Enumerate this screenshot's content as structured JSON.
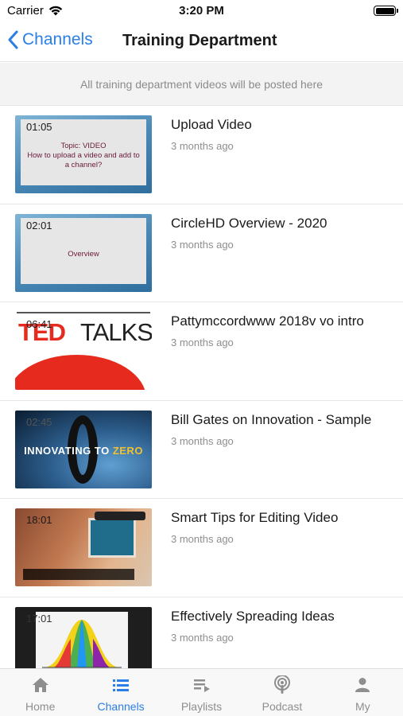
{
  "status_bar": {
    "carrier": "Carrier",
    "time": "3:20 PM"
  },
  "nav": {
    "back_label": "Channels",
    "title": "Training Department"
  },
  "banner": {
    "text": "All training department videos will be posted here"
  },
  "videos": [
    {
      "title": "Upload Video",
      "date": "3 months ago",
      "duration": "01:05",
      "thumb_text": "Topic: VIDEO\nHow to upload a video and add to a channel?"
    },
    {
      "title": "CircleHD Overview - 2020",
      "date": "3 months ago",
      "duration": "02:01",
      "thumb_text": "Overview"
    },
    {
      "title": "Pattymccordwww 2018v vo intro",
      "date": "3 months ago",
      "duration": "06:41",
      "thumb_ted": "TED",
      "thumb_talks": "TALKS"
    },
    {
      "title": "Bill Gates on Innovation - Sample",
      "date": "3 months ago",
      "duration": "02:45",
      "thumb_caption": "INNOVATING TO",
      "thumb_caption_zero": "ZERO"
    },
    {
      "title": "Smart Tips for Editing Video",
      "date": "3 months ago",
      "duration": "18:01"
    },
    {
      "title": "Effectively Spreading Ideas",
      "date": "3 months ago",
      "duration": "17:01"
    }
  ],
  "tabs": [
    {
      "label": "Home",
      "icon": "home-icon",
      "active": false
    },
    {
      "label": "Channels",
      "icon": "list-icon",
      "active": true
    },
    {
      "label": "Playlists",
      "icon": "playlist-icon",
      "active": false
    },
    {
      "label": "Podcast",
      "icon": "podcast-icon",
      "active": false
    },
    {
      "label": "My",
      "icon": "person-icon",
      "active": false
    }
  ],
  "colors": {
    "accent": "#2a7ee6",
    "inactive": "#8e8e8e",
    "ted_red": "#e62b1e"
  }
}
